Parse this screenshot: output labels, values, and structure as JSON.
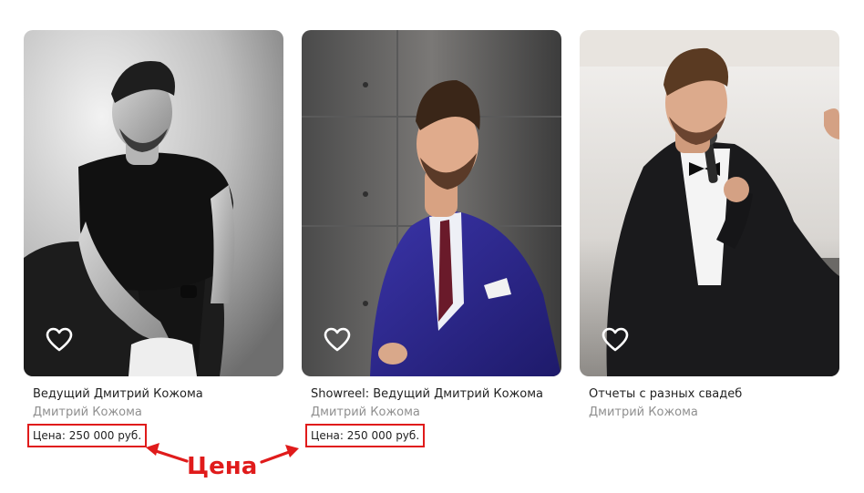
{
  "cards": [
    {
      "title": "Ведущий Дмитрий Кожома",
      "author": "Дмитрий Кожома",
      "price": "Цена: 250 000 руб.",
      "favorite_icon": "heart-outline-icon"
    },
    {
      "title": "Showreel: Ведущий Дмитрий Кожома",
      "author": "Дмитрий Кожома",
      "price": "Цена: 250 000 руб.",
      "favorite_icon": "heart-outline-icon"
    },
    {
      "title": "Отчеты с разных свадеб",
      "author": "Дмитрий Кожома"
    }
  ],
  "annotation": {
    "label": "Цена",
    "color": "#e01b1b"
  }
}
